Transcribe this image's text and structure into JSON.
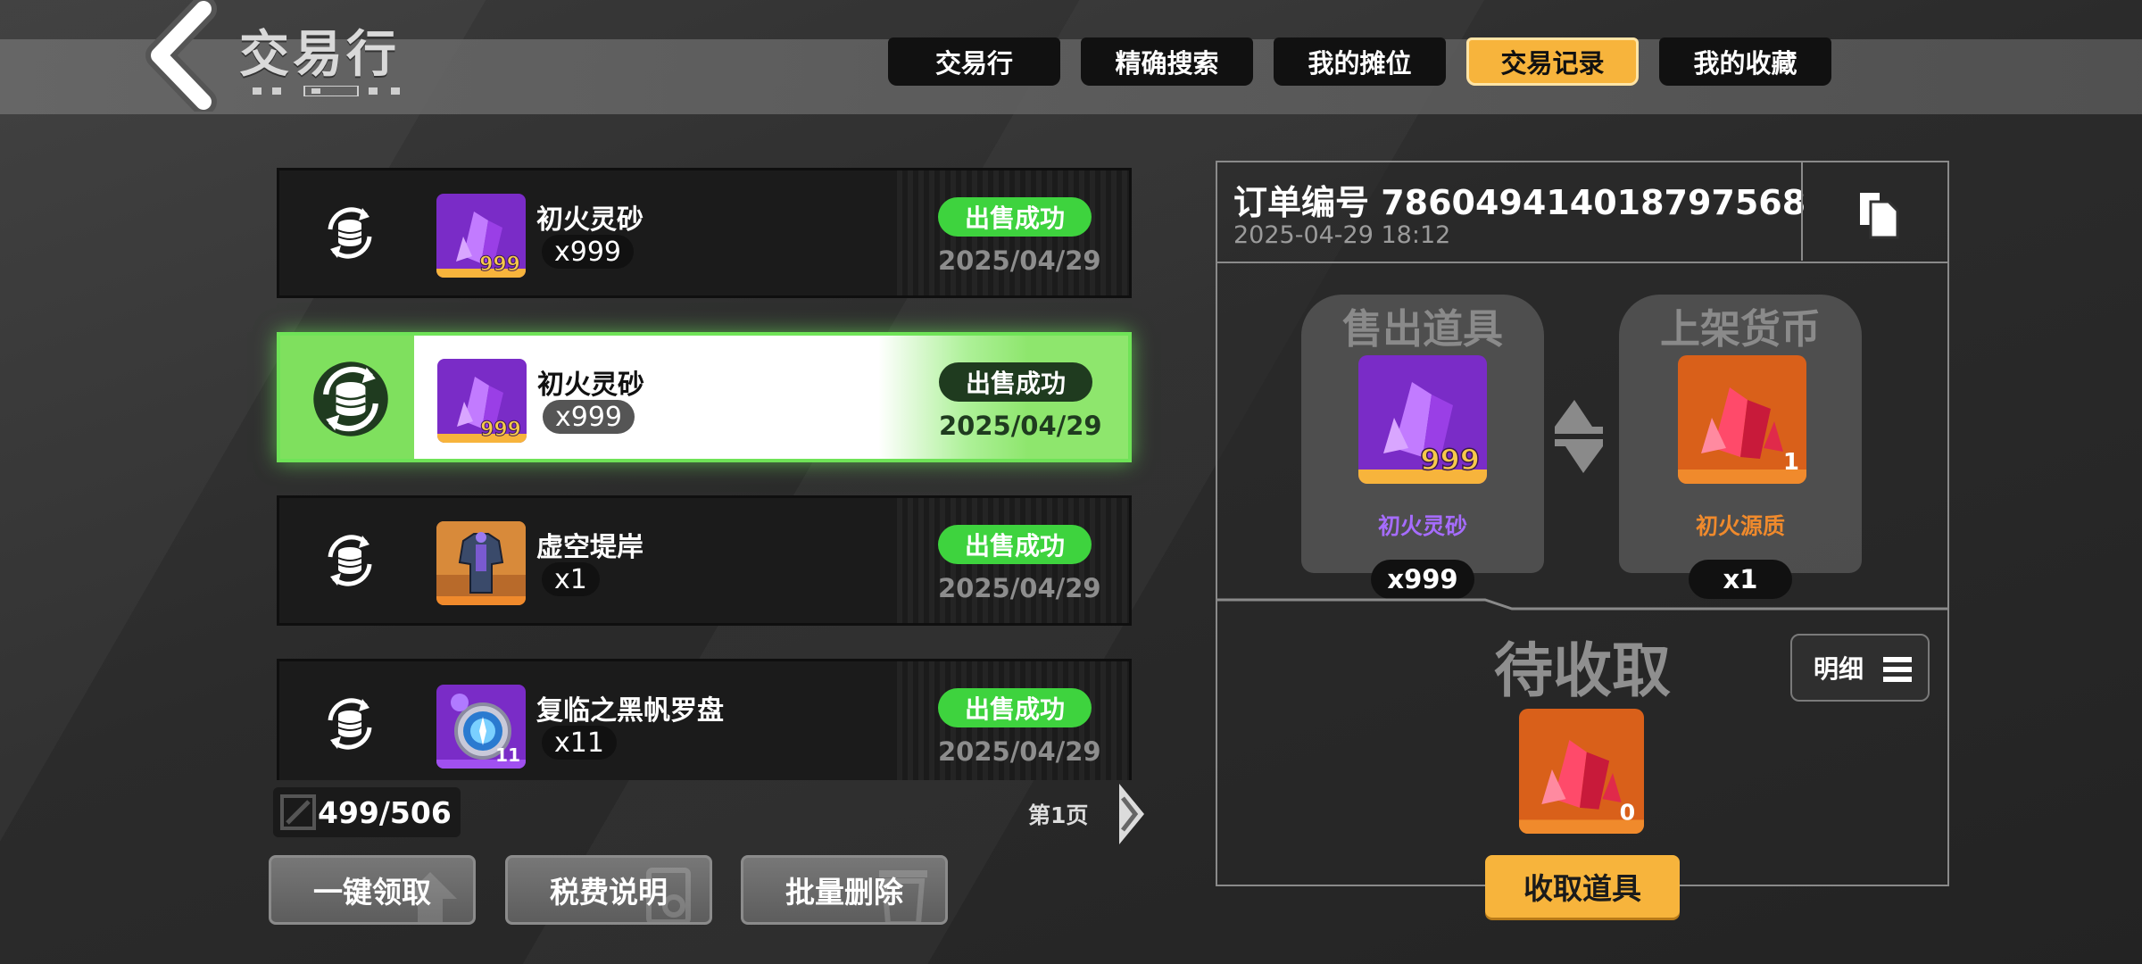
{
  "header": {
    "title": "交易行",
    "tabs": [
      {
        "label": "交易行",
        "active": false
      },
      {
        "label": "精确搜索",
        "active": false
      },
      {
        "label": "我的摊位",
        "active": false
      },
      {
        "label": "交易记录",
        "active": true
      },
      {
        "label": "我的收藏",
        "active": false
      }
    ]
  },
  "records": [
    {
      "name": "初火灵砂",
      "qty": "x999",
      "icon_count": "999",
      "status": "出售成功",
      "date": "2025/04/29",
      "icon": "purple-crystal-icon",
      "selected": false
    },
    {
      "name": "初火灵砂",
      "qty": "x999",
      "icon_count": "999",
      "status": "出售成功",
      "date": "2025/04/29",
      "icon": "purple-crystal-icon",
      "selected": true
    },
    {
      "name": "虚空堤岸",
      "qty": "x1",
      "icon_count": "",
      "status": "出售成功",
      "date": "2025/04/29",
      "icon": "armor-icon",
      "selected": false
    },
    {
      "name": "复临之黑帆罗盘",
      "qty": "x11",
      "icon_count": "11",
      "status": "出售成功",
      "date": "2025/04/29",
      "icon": "compass-icon",
      "selected": false
    }
  ],
  "list_footer": {
    "count": "499/506",
    "page": "第1页"
  },
  "actions": {
    "claim_all": "一键领取",
    "tax_info": "税费说明",
    "batch_delete": "批量删除"
  },
  "order": {
    "label": "订单编号 786049414018797568",
    "time": "2025-04-29 18:12",
    "sold_title": "售出道具",
    "sold_name": "初火灵砂",
    "sold_qty": "x999",
    "sold_icon_count": "999",
    "currency_title": "上架货币",
    "currency_name": "初火源质",
    "currency_qty": "x1",
    "currency_icon_count": "1",
    "pending_title": "待收取",
    "pending_icon_count": "0",
    "detail_label": "明细",
    "claim_label": "收取道具"
  },
  "colors": {
    "accent": "#f7b43c",
    "success": "#3ed33e",
    "purple_name": "#a66cff",
    "orange_name": "#f08a2c"
  }
}
